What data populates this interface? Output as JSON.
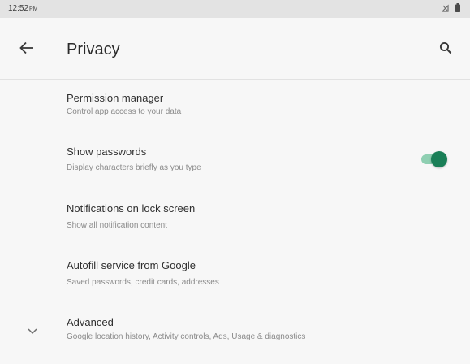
{
  "status_bar": {
    "time": "12:52",
    "time_suffix": "PM",
    "icons": [
      "signal-icon",
      "battery-icon"
    ]
  },
  "app_bar": {
    "title": "Privacy",
    "back_icon": "back-arrow-icon",
    "search_icon": "search-icon"
  },
  "preferences": [
    {
      "title": "Permission manager",
      "summary": "Control app access to your data"
    },
    {
      "title": "Show passwords",
      "summary": "Display characters briefly as you type",
      "toggle_on": true
    },
    {
      "title": "Notifications on lock screen",
      "summary": "Show all notification content"
    },
    {
      "title": "Autofill service from Google",
      "summary": "Saved passwords, credit cards, addresses"
    },
    {
      "title": "Advanced",
      "summary": "Google location history, Activity controls, Ads, Usage & diagnostics",
      "icon": "chevron-down-icon"
    }
  ],
  "colors": {
    "background": "#f7f7f7",
    "status_bar": "#e3e3e3",
    "toggle_thumb": "#1a7f57",
    "toggle_track": "#8fcfb2",
    "divider": "#dedede"
  }
}
